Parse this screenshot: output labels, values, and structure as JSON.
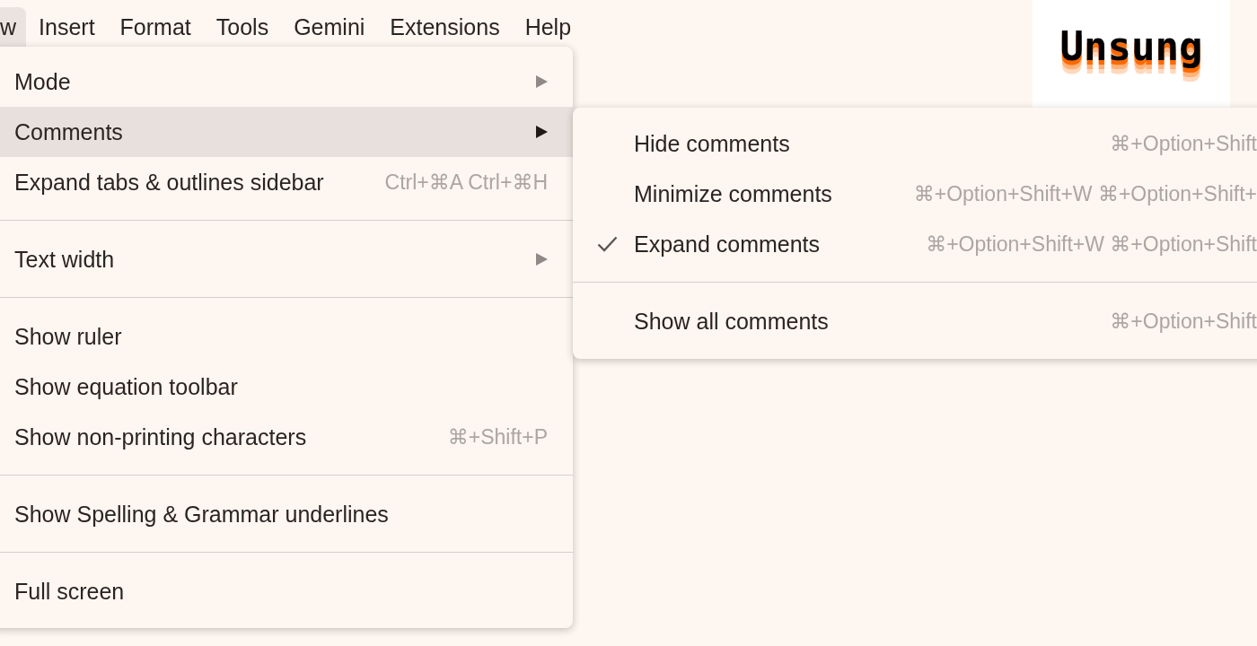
{
  "menu_bar": [
    {
      "label": "w",
      "selected": true
    },
    {
      "label": "Insert",
      "selected": false
    },
    {
      "label": "Format",
      "selected": false
    },
    {
      "label": "Tools",
      "selected": false
    },
    {
      "label": "Gemini",
      "selected": false
    },
    {
      "label": "Extensions",
      "selected": false
    },
    {
      "label": "Help",
      "selected": false
    }
  ],
  "logo": {
    "text": "Unsung"
  },
  "view_menu": {
    "sections": [
      {
        "items": [
          {
            "label": "Mode",
            "kind": "submenu",
            "selected": false
          },
          {
            "label": "Comments",
            "kind": "submenu",
            "selected": true
          },
          {
            "label": "Expand tabs & outlines sidebar",
            "kind": "command",
            "shortcut": "Ctrl+⌘A Ctrl+⌘H",
            "selected": false
          }
        ]
      },
      {
        "items": [
          {
            "label": "Text width",
            "kind": "submenu",
            "selected": false
          }
        ]
      },
      {
        "items": [
          {
            "label": "Show ruler",
            "kind": "command",
            "selected": false
          },
          {
            "label": "Show equation toolbar",
            "kind": "command",
            "selected": false
          },
          {
            "label": "Show non-printing characters",
            "kind": "command",
            "shortcut": "⌘+Shift+P",
            "selected": false
          }
        ]
      },
      {
        "items": [
          {
            "label": "Show Spelling & Grammar underlines",
            "kind": "command",
            "selected": false
          }
        ]
      },
      {
        "items": [
          {
            "label": "Full screen",
            "kind": "command",
            "selected": false
          }
        ]
      }
    ]
  },
  "comments_submenu": {
    "sections": [
      {
        "items": [
          {
            "label": "Hide comments",
            "checked": false,
            "shortcut": "⌘+Option+Shift"
          },
          {
            "label": "Minimize comments",
            "checked": false,
            "shortcut": "⌘+Option+Shift+W ⌘+Option+Shift+"
          },
          {
            "label": "Expand comments",
            "checked": true,
            "shortcut": "⌘+Option+Shift+W ⌘+Option+Shift"
          }
        ]
      },
      {
        "items": [
          {
            "label": "Show all comments",
            "checked": false,
            "shortcut": "⌘+Option+Shift"
          }
        ]
      }
    ]
  }
}
